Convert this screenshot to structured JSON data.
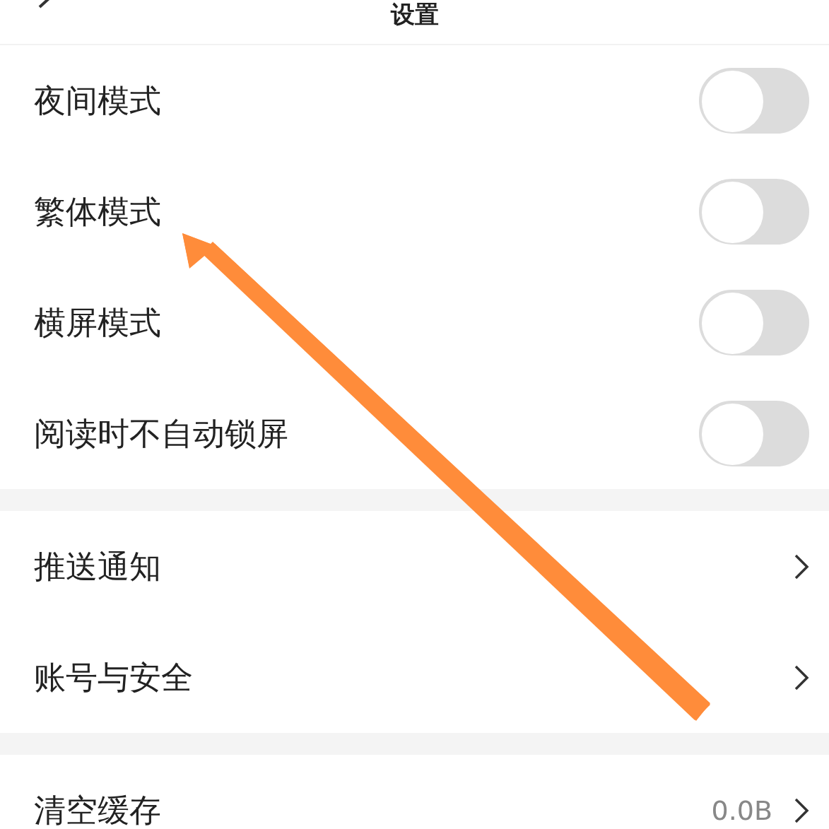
{
  "header": {
    "title": "设置"
  },
  "sections": [
    {
      "items": [
        {
          "kind": "toggle",
          "label": "夜间模式",
          "on": false
        },
        {
          "kind": "toggle",
          "label": "繁体模式",
          "on": false
        },
        {
          "kind": "toggle",
          "label": "横屏模式",
          "on": false
        },
        {
          "kind": "toggle",
          "label": "阅读时不自动锁屏",
          "on": false
        }
      ]
    },
    {
      "items": [
        {
          "kind": "link",
          "label": "推送通知"
        },
        {
          "kind": "link",
          "label": "账号与安全"
        }
      ]
    },
    {
      "items": [
        {
          "kind": "link",
          "label": "清空缓存",
          "value": "0.0B"
        }
      ]
    }
  ],
  "annotation": {
    "kind": "arrow"
  }
}
